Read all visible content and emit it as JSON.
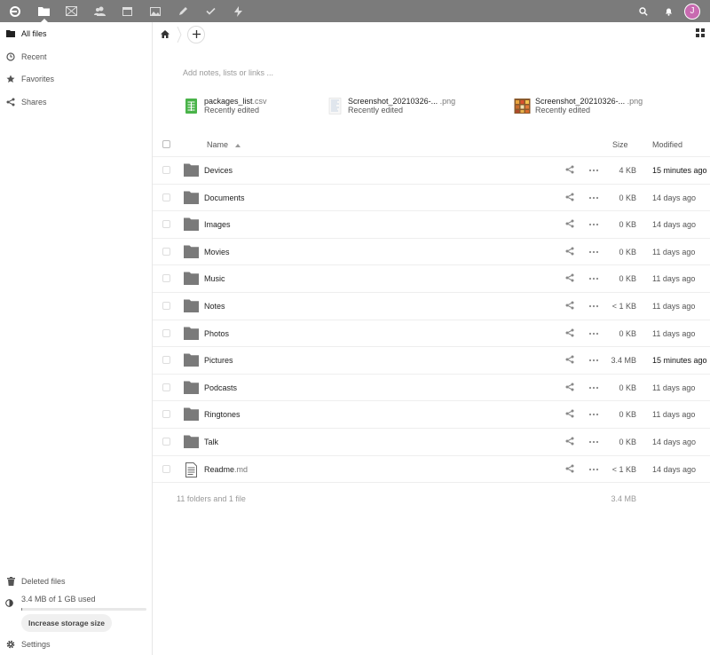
{
  "topbar": {
    "apps": [
      "files-icon",
      "photos-grid-icon",
      "contacts-icon",
      "calendar-icon",
      "image-icon",
      "pencil-icon",
      "check-icon",
      "activity-icon"
    ],
    "user_initial": "J",
    "colors": {
      "header": "#7b7b7b",
      "avatar": "#c86ab0"
    }
  },
  "nav": {
    "items": [
      {
        "label": "All files",
        "icon": "folder-icon"
      },
      {
        "label": "Recent",
        "icon": "clock-icon"
      },
      {
        "label": "Favorites",
        "icon": "star-icon"
      },
      {
        "label": "Shares",
        "icon": "share-icon"
      }
    ],
    "deleted_label": "Deleted files",
    "quota_text": "3.4 MB of 1 GB used",
    "quota_fraction": 0.0034,
    "increase_label": "Increase storage size",
    "settings_label": "Settings"
  },
  "main": {
    "notes_placeholder": "Add notes, lists or links ...",
    "recent": [
      {
        "name": "packages_list",
        "ext": ".csv",
        "sub": "Recently edited",
        "icon": "spreadsheet-icon"
      },
      {
        "name": "Screenshot_20210326-...",
        "ext": ".png",
        "sub": "Recently edited",
        "icon": "image-thumb-icon"
      },
      {
        "name": "Screenshot_20210326-...",
        "ext": ".png",
        "sub": "Recently edited",
        "icon": "image-thumb-icon"
      }
    ],
    "columns": {
      "name": "Name",
      "size": "Size",
      "modified": "Modified"
    },
    "files": [
      {
        "name": "Devices",
        "ext": "",
        "size": "4 KB",
        "modified": "15 minutes ago",
        "type": "folder",
        "recent": true
      },
      {
        "name": "Documents",
        "ext": "",
        "size": "0 KB",
        "modified": "14 days ago",
        "type": "folder",
        "recent": false
      },
      {
        "name": "Images",
        "ext": "",
        "size": "0 KB",
        "modified": "14 days ago",
        "type": "folder",
        "recent": false
      },
      {
        "name": "Movies",
        "ext": "",
        "size": "0 KB",
        "modified": "11 days ago",
        "type": "folder",
        "recent": false
      },
      {
        "name": "Music",
        "ext": "",
        "size": "0 KB",
        "modified": "11 days ago",
        "type": "folder",
        "recent": false
      },
      {
        "name": "Notes",
        "ext": "",
        "size": "< 1 KB",
        "modified": "11 days ago",
        "type": "folder",
        "recent": false
      },
      {
        "name": "Photos",
        "ext": "",
        "size": "0 KB",
        "modified": "11 days ago",
        "type": "folder",
        "recent": false
      },
      {
        "name": "Pictures",
        "ext": "",
        "size": "3.4 MB",
        "modified": "15 minutes ago",
        "type": "folder",
        "recent": true
      },
      {
        "name": "Podcasts",
        "ext": "",
        "size": "0 KB",
        "modified": "11 days ago",
        "type": "folder",
        "recent": false
      },
      {
        "name": "Ringtones",
        "ext": "",
        "size": "0 KB",
        "modified": "11 days ago",
        "type": "folder",
        "recent": false
      },
      {
        "name": "Talk",
        "ext": "",
        "size": "0 KB",
        "modified": "14 days ago",
        "type": "folder",
        "recent": false
      },
      {
        "name": "Readme",
        "ext": ".md",
        "size": "< 1 KB",
        "modified": "14 days ago",
        "type": "file",
        "recent": false
      }
    ],
    "summary": "11 folders and 1 file",
    "summary_size": "3.4 MB"
  }
}
